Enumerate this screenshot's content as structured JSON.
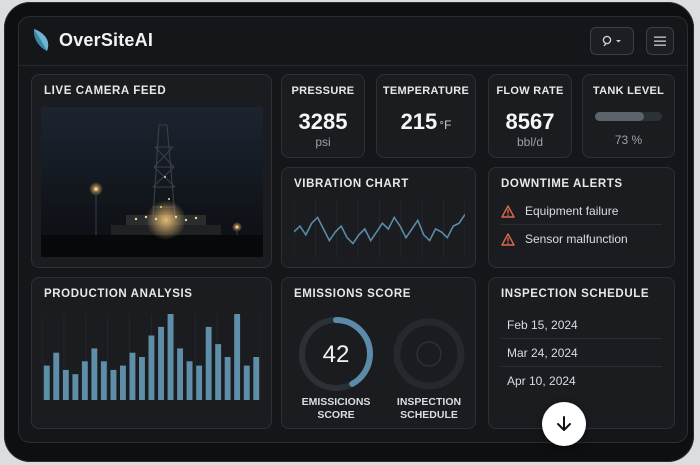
{
  "app": {
    "name": "OverSiteAI"
  },
  "topbar": {
    "user_icon": "user-icon",
    "menu_icon": "hamburger-menu-icon"
  },
  "camera": {
    "title": "LIVE CAMERA FEED"
  },
  "metrics": [
    {
      "label": "PRESSURE",
      "value": "3285",
      "unit": "psi"
    },
    {
      "label": "TEMPERATURE",
      "value": "215",
      "unit": "°F"
    },
    {
      "label": "FLOW RATE",
      "value": "8567",
      "unit": "bbl/d"
    },
    {
      "label": "TANK LEVEL",
      "percent": 73,
      "text": "73 %"
    }
  ],
  "vibration": {
    "title": "VIBRATION CHART",
    "series": [
      0.45,
      0.55,
      0.4,
      0.6,
      0.7,
      0.5,
      0.3,
      0.45,
      0.55,
      0.35,
      0.25,
      0.4,
      0.5,
      0.3,
      0.45,
      0.6,
      0.5,
      0.7,
      0.55,
      0.35,
      0.5,
      0.65,
      0.4,
      0.3,
      0.5,
      0.45,
      0.35,
      0.55,
      0.6,
      0.75
    ]
  },
  "downtime": {
    "title": "DOWNTIME ALERTS",
    "alerts": [
      "Equipment failure",
      "Sensor malfunction"
    ],
    "warning_color": "#e0674f"
  },
  "production": {
    "title": "PRODUCTION ANALYSIS",
    "bars": [
      0.4,
      0.55,
      0.35,
      0.3,
      0.45,
      0.6,
      0.45,
      0.35,
      0.4,
      0.55,
      0.5,
      0.75,
      0.85,
      1.0,
      0.6,
      0.45,
      0.4,
      0.85,
      0.65,
      0.5,
      1.0,
      0.4,
      0.5
    ]
  },
  "emissions": {
    "title": "EMISSIONS SCORE",
    "score": "42",
    "score_fraction": 0.42,
    "gauge1_label": "EMISSICIONS SCORE",
    "gauge2_label": "INSPECTION SCHEDULE"
  },
  "inspection": {
    "title": "INSPECTION SCHEDULE",
    "dates": [
      "Feb 15, 2024",
      "Mar 24, 2024",
      "Apr 10, 2024"
    ]
  },
  "colors": {
    "accent": "#5b8ba8",
    "bar": "#5f8ea9"
  }
}
